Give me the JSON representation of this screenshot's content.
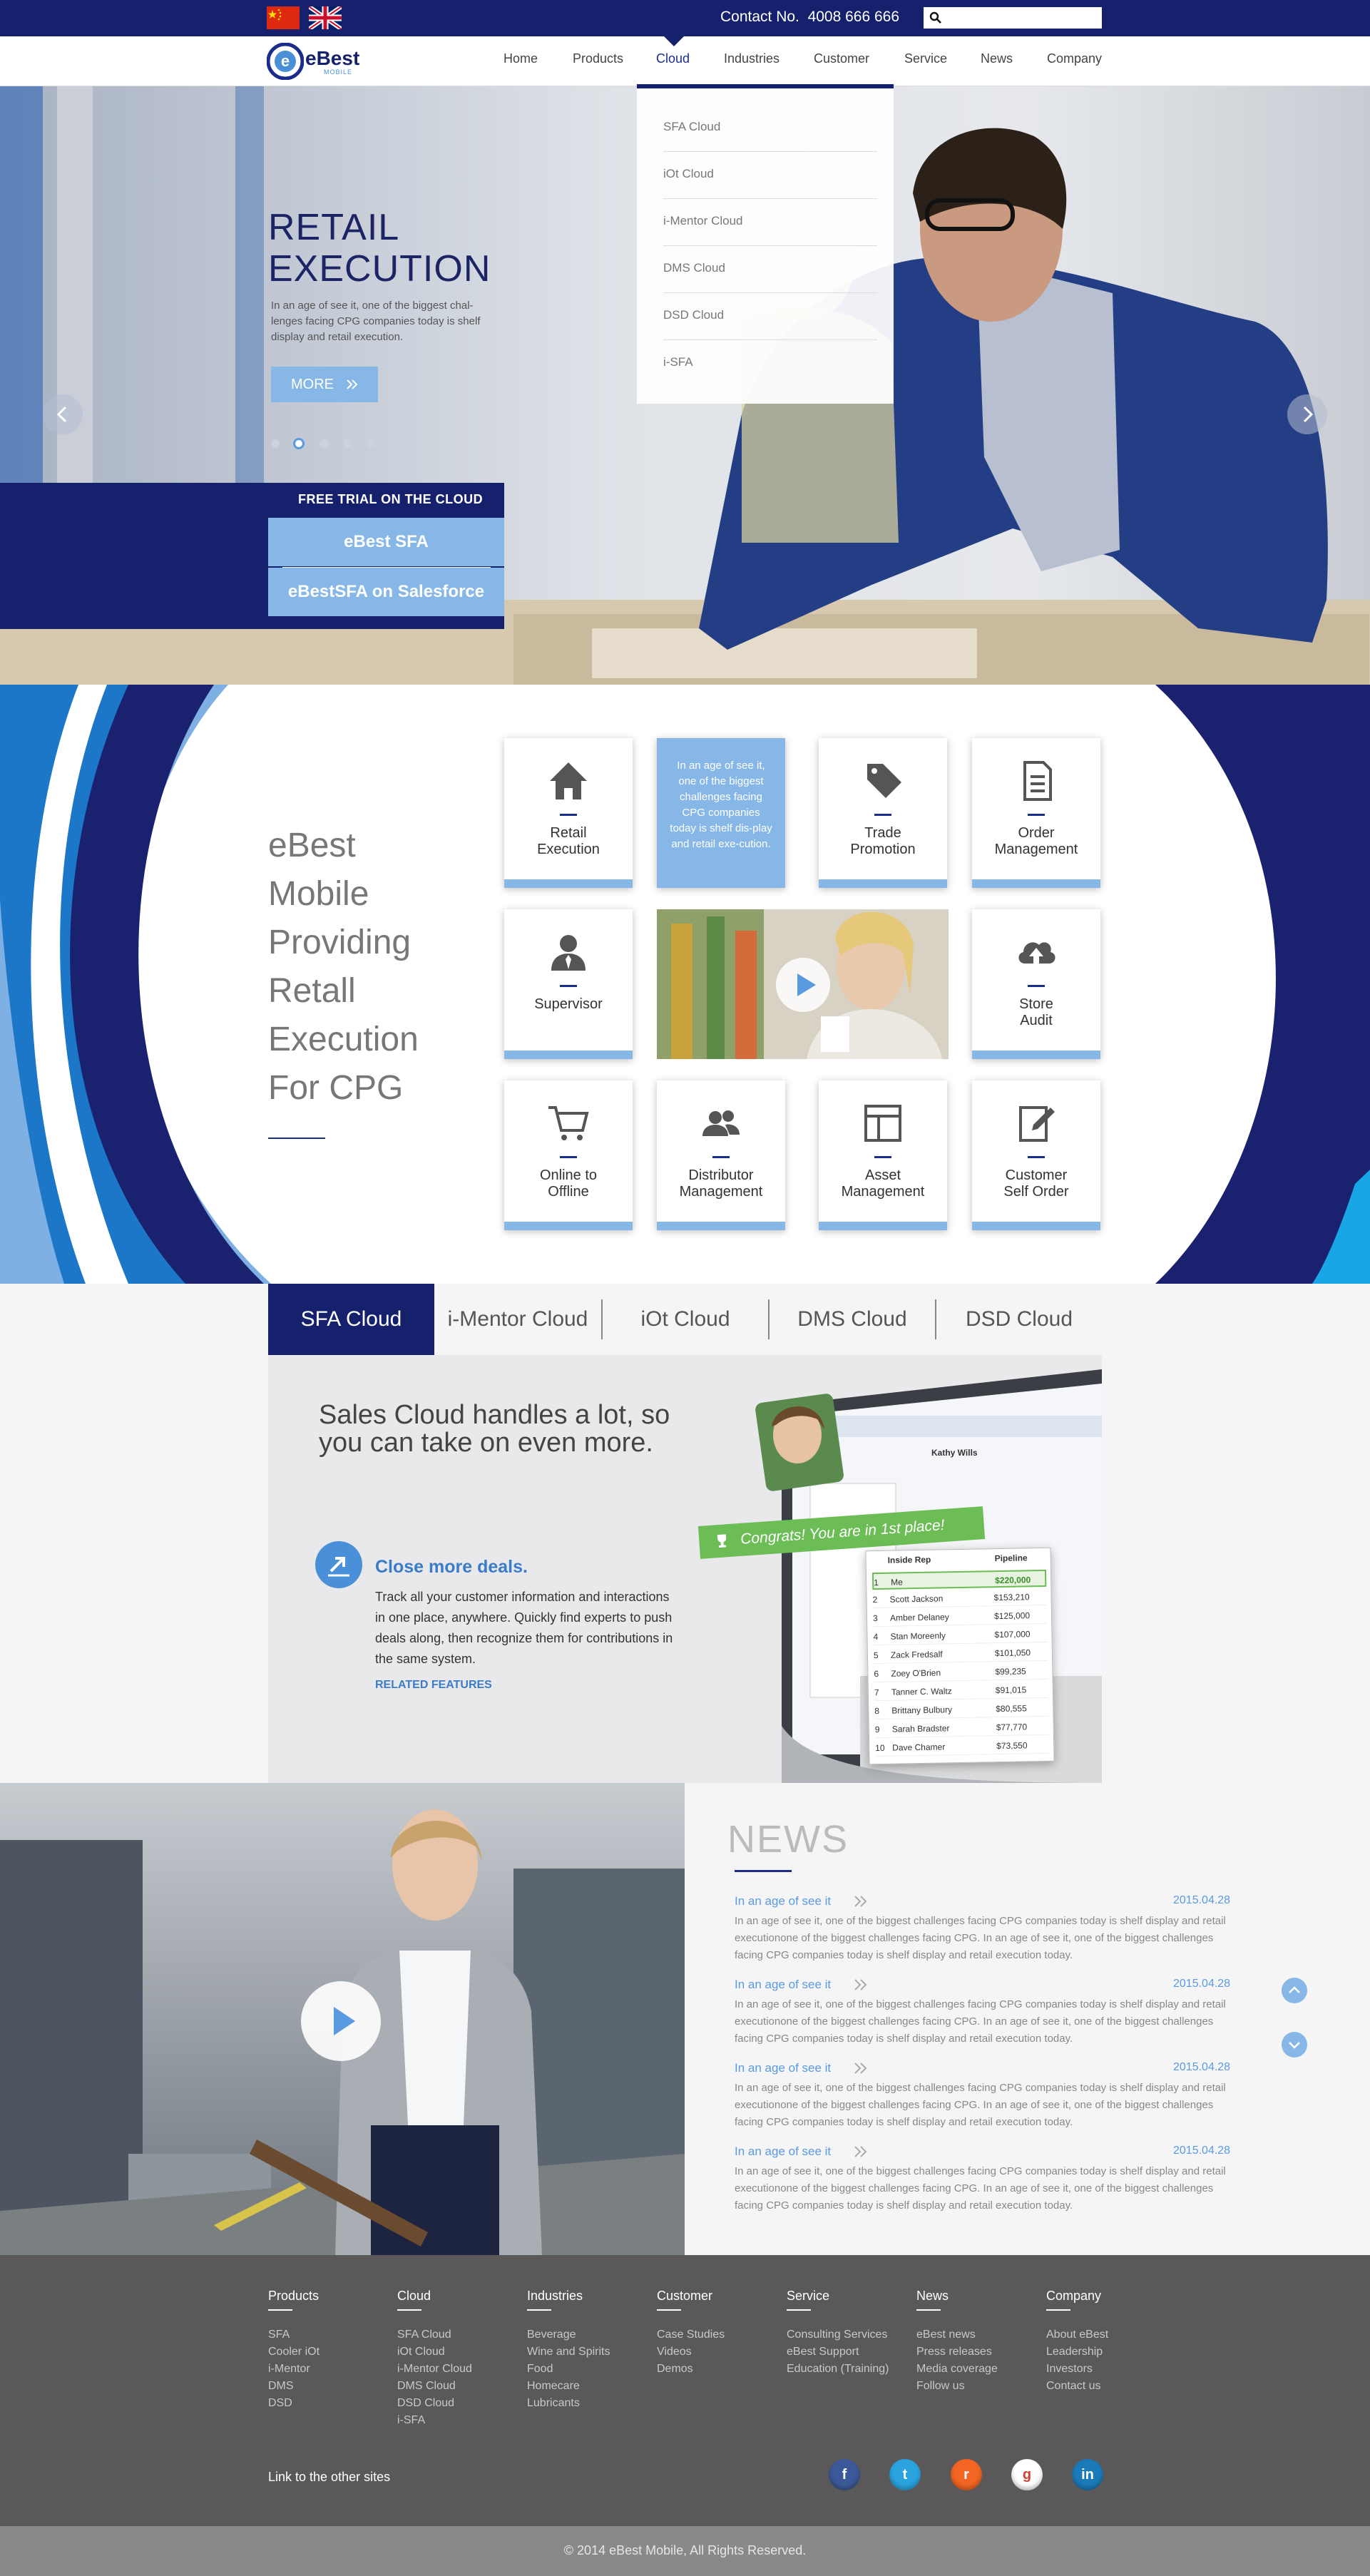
{
  "topbar": {
    "contact_label": "Contact No.",
    "contact_number": "4008 666 666",
    "search_placeholder": "",
    "flags": [
      "china-flag",
      "uk-flag"
    ]
  },
  "brand": {
    "logo_text": "eBest",
    "logo_sub": "MOBILE"
  },
  "nav": {
    "items": [
      "Home",
      "Products",
      "Cloud",
      "Industries",
      "Customer",
      "Service",
      "News",
      "Company"
    ],
    "active": "Cloud"
  },
  "cloud_menu": {
    "items": [
      "SFA Cloud",
      "iOt Cloud",
      "i-Mentor Cloud",
      "DMS Cloud",
      "DSD Cloud",
      "i-SFA"
    ]
  },
  "hero": {
    "title_line1": "RETAIL",
    "title_line2": "EXECUTION",
    "text": "In an age of see it, one of the biggest chal-lenges facing CPG companies today is shelf display and retail execution.",
    "more_label": "MORE",
    "slide_count": 5,
    "active_slide": 2
  },
  "trial": {
    "title": "FREE TRIAL ON THE CLOUD",
    "buttons": [
      "eBest SFA",
      "eBestSFA on Salesforce"
    ]
  },
  "features": {
    "heading_lines": [
      "eBest",
      "Mobile",
      "Providing",
      "Retall",
      "Execution",
      "For CPG"
    ],
    "highlight_text": "In an age of see it, one of the biggest challenges facing CPG companies today is shelf dis-play and retail exe-cution.",
    "cards": [
      {
        "icon": "home-icon",
        "label1": "Retail",
        "label2": "Execution"
      },
      {
        "icon": "tag-icon",
        "label1": "Trade",
        "label2": "Promotion"
      },
      {
        "icon": "document-icon",
        "label1": "Order",
        "label2": "Management"
      },
      {
        "icon": "supervisor-icon",
        "label1": "Supervisor",
        "label2": ""
      },
      {
        "icon": "cloud-upload-icon",
        "label1": "Store",
        "label2": "Audit"
      },
      {
        "icon": "cart-icon",
        "label1": "Online to",
        "label2": "Offline"
      },
      {
        "icon": "users-icon",
        "label1": "Distributor",
        "label2": "Management"
      },
      {
        "icon": "layout-icon",
        "label1": "Asset",
        "label2": "Management"
      },
      {
        "icon": "edit-icon",
        "label1": "Customer",
        "label2": "Self Order"
      }
    ]
  },
  "cloud_tabs": {
    "tabs": [
      "SFA Cloud",
      "i-Mentor Cloud",
      "iOt Cloud",
      "DMS Cloud",
      "DSD Cloud"
    ],
    "active": "SFA Cloud",
    "panel_title": "Sales Cloud handles a lot, so you can take on even more.",
    "deals_title": "Close more deals.",
    "deals_text": "Track all your customer information and interactions in one place, anywhere. Quickly find experts to push deals along, then recognize them for contributions in the same system.",
    "related": "RELATED FEATURES",
    "congrats": "Congrats! You are in 1st place!",
    "leaderboard_title": "Inside Rep",
    "leaderboard_col": "Pipeline",
    "profile_name": "Kathy Wills",
    "leaderboard": [
      {
        "rank": "1",
        "name": "Me",
        "value": "$220,000"
      },
      {
        "rank": "2",
        "name": "Scott Jackson",
        "value": "$153,210"
      },
      {
        "rank": "3",
        "name": "Amber Delaney",
        "value": "$125,000"
      },
      {
        "rank": "4",
        "name": "Stan Moreenly",
        "value": "$107,000"
      },
      {
        "rank": "5",
        "name": "Zack Fredsalf",
        "value": "$101,050"
      },
      {
        "rank": "6",
        "name": "Zoey O'Brien",
        "value": "$99,235"
      },
      {
        "rank": "7",
        "name": "Tanner C. Waltz",
        "value": "$91,015"
      },
      {
        "rank": "8",
        "name": "Brittany Bulbury",
        "value": "$80,555"
      },
      {
        "rank": "9",
        "name": "Sarah Bradster",
        "value": "$77,770"
      },
      {
        "rank": "10",
        "name": "Dave Chamer",
        "value": "$73,550"
      }
    ]
  },
  "news": {
    "title": "NEWS",
    "items": [
      {
        "head": "In an age of see it",
        "date": "2015.04.28",
        "body": "In an age of see it, one of the biggest challenges facing CPG companies today is shelf display and retail executionone of the biggest challenges facing CPG. In an age of see it, one of the biggest challenges facing CPG companies today is shelf display and retail execution today."
      },
      {
        "head": "In an age of see it",
        "date": "2015.04.28",
        "body": "In an age of see it, one of the biggest challenges facing CPG companies today is shelf display and retail executionone of the biggest challenges facing CPG. In an age of see it, one of the biggest challenges facing CPG companies today is shelf display and retail execution today."
      },
      {
        "head": "In an age of see it",
        "date": "2015.04.28",
        "body": "In an age of see it, one of the biggest challenges facing CPG companies today is shelf display and retail executionone of the biggest challenges facing CPG. In an age of see it, one of the biggest challenges facing CPG companies today is shelf display and retail execution today."
      },
      {
        "head": "In an age of see it",
        "date": "2015.04.28",
        "body": "In an age of see it, one of the biggest challenges facing CPG companies today is shelf display and retail executionone of the biggest challenges facing CPG. In an age of see it, one of the biggest challenges facing CPG companies today is shelf display and retail execution today."
      }
    ]
  },
  "footer": {
    "columns": [
      {
        "title": "Products",
        "links": [
          "SFA",
          "Cooler iOt",
          "i-Mentor",
          "DMS",
          "DSD"
        ]
      },
      {
        "title": "Cloud",
        "links": [
          "SFA Cloud",
          "iOt Cloud",
          "i-Mentor Cloud",
          "DMS Cloud",
          "DSD Cloud",
          "i-SFA"
        ]
      },
      {
        "title": "Industries",
        "links": [
          "Beverage",
          "Wine and Spirits",
          "Food",
          "Homecare",
          "Lubricants"
        ]
      },
      {
        "title": "Customer",
        "links": [
          "Case Studies",
          "Videos",
          "Demos"
        ]
      },
      {
        "title": "Service",
        "links": [
          "Consulting Services",
          "eBest  Support",
          "Education (Training)"
        ]
      },
      {
        "title": "News",
        "links": [
          "eBest news",
          "Press releases",
          "Media coverage",
          "Follow us"
        ]
      },
      {
        "title": "Company",
        "links": [
          "About eBest",
          "Leadership",
          "Investors",
          "Contact us"
        ]
      }
    ],
    "other_sites": "Link to the other sites",
    "social": [
      {
        "name": "facebook-icon",
        "glyph": "f",
        "color": "#3b5998"
      },
      {
        "name": "twitter-icon",
        "glyph": "t",
        "color": "#2aa3df"
      },
      {
        "name": "rss-icon",
        "glyph": "r",
        "color": "#f26522"
      },
      {
        "name": "google-plus-icon",
        "glyph": "g",
        "color": "#ffffff"
      },
      {
        "name": "linkedin-icon",
        "glyph": "in",
        "color": "#1b7ab8"
      }
    ],
    "copyright": "© 2014 eBest Mobile, All Rights Reserved."
  }
}
